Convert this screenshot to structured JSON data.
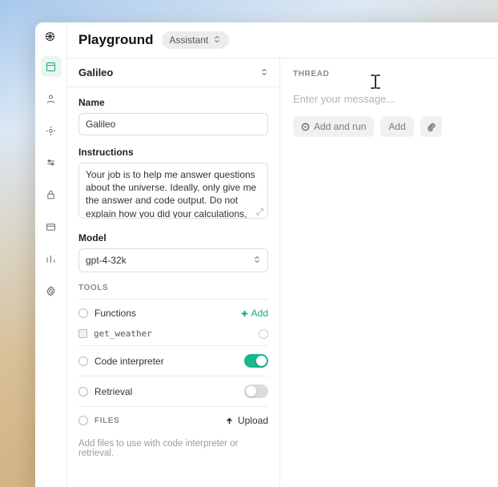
{
  "header": {
    "title": "Playground",
    "mode_pill": "Assistant"
  },
  "assistant": {
    "selected_name": "Galileo",
    "name_label": "Name",
    "name_value": "Galileo",
    "instructions_label": "Instructions",
    "instructions_value": "Your job is to help me answer questions about the universe. Ideally, only give me the answer and code output. Do not explain how you did your calculations, just output a python program and answer.",
    "model_label": "Model",
    "model_value": "gpt-4-32k"
  },
  "tools": {
    "section_label": "TOOLS",
    "functions": {
      "label": "Functions",
      "add_label": "Add",
      "items": [
        {
          "name": "get_weather"
        }
      ]
    },
    "code_interpreter": {
      "label": "Code interpreter",
      "enabled": true
    },
    "retrieval": {
      "label": "Retrieval",
      "enabled": false
    },
    "files": {
      "label": "FILES",
      "upload_label": "Upload",
      "hint": "Add files to use with code interpreter or retrieval."
    }
  },
  "thread": {
    "label": "THREAD",
    "placeholder": "Enter your message...",
    "buttons": {
      "add_and_run": "Add and run",
      "add": "Add"
    }
  }
}
